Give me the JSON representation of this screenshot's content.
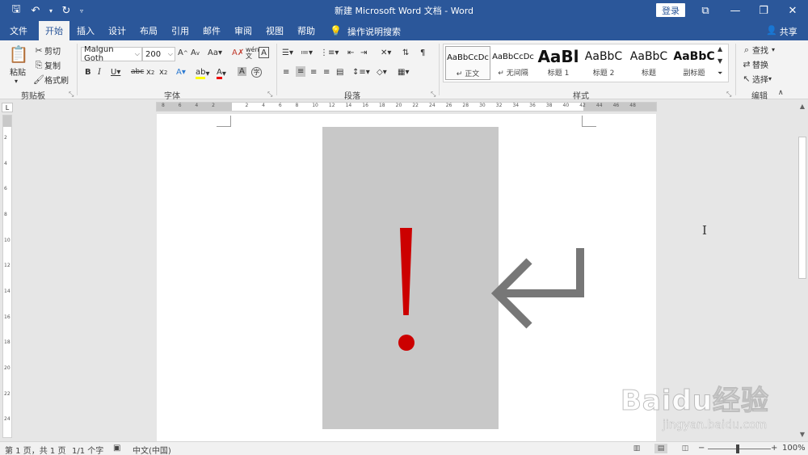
{
  "qat": {
    "save_icon": "save-icon",
    "undo_icon": "undo-icon",
    "redo_icon": "redo-icon",
    "customize_icon": "customize-qat-icon"
  },
  "window": {
    "title": "新建 Microsoft Word 文档 - Word",
    "login": "登录"
  },
  "tabs": [
    "文件",
    "开始",
    "插入",
    "设计",
    "布局",
    "引用",
    "邮件",
    "审阅",
    "视图",
    "帮助"
  ],
  "active_tab": "开始",
  "tell_me": "操作说明搜索",
  "share": "共享",
  "clipboard": {
    "paste": "粘贴",
    "cut": "剪切",
    "copy": "复制",
    "format_painter": "格式刷",
    "label": "剪贴板"
  },
  "font": {
    "name": "Malgun Goth",
    "size": "200",
    "label": "字体"
  },
  "paragraph": {
    "label": "段落"
  },
  "styles": {
    "label": "样式",
    "items": [
      {
        "sample": "AaBbCcDc",
        "name": "↵ 正文"
      },
      {
        "sample": "AaBbCcDc",
        "name": "↵ 无间隔"
      },
      {
        "sample": "AaBl",
        "name": "标题 1"
      },
      {
        "sample": "AaBbC",
        "name": "标题 2"
      },
      {
        "sample": "AaBbC",
        "name": "标题"
      },
      {
        "sample": "AaBbC",
        "name": "副标题"
      }
    ]
  },
  "editing": {
    "find": "查找",
    "replace": "替换",
    "select": "选择",
    "label": "编辑"
  },
  "ruler_numbers": [
    "8",
    "6",
    "4",
    "2",
    "",
    "2",
    "4",
    "6",
    "8",
    "10",
    "12",
    "14",
    "16",
    "18",
    "20",
    "22",
    "24",
    "26",
    "28",
    "30",
    "32",
    "34",
    "36",
    "38",
    "40",
    "42",
    "44",
    "46",
    "48"
  ],
  "vruler_numbers": [
    "2",
    "4",
    "6",
    "8",
    "10",
    "12",
    "14",
    "16",
    "18",
    "20",
    "22",
    "24"
  ],
  "document": {
    "slide_color": "#c8c8c8",
    "exclamation_color": "#cc0000",
    "arrow_color": "#777777",
    "arrow_icon": "return-arrow-icon"
  },
  "status": {
    "page": "第 1 页，共 1 页",
    "words": "1/1 个字",
    "language": "中文(中国)",
    "zoom": "100%"
  },
  "watermark": {
    "main": "Baidu经验",
    "sub": "jingyan.baidu.com"
  }
}
